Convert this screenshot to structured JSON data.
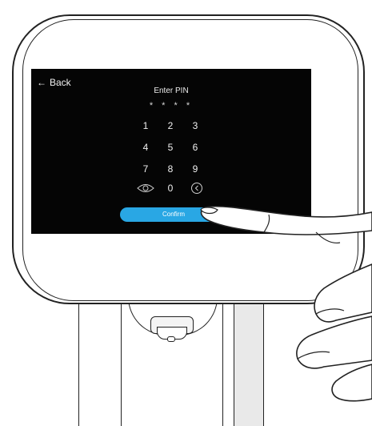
{
  "screen": {
    "back_label": "Back",
    "back_icon": "arrow-left-icon",
    "title": "Enter PIN",
    "pin_mask": "* * * *",
    "keys": [
      "1",
      "2",
      "3",
      "4",
      "5",
      "6",
      "7",
      "8",
      "9",
      "0"
    ],
    "show_pin_icon": "eye-icon",
    "backspace_icon": "chevron-left-circle-icon",
    "confirm_label": "Confirm",
    "accent_color": "#29a7e4"
  }
}
